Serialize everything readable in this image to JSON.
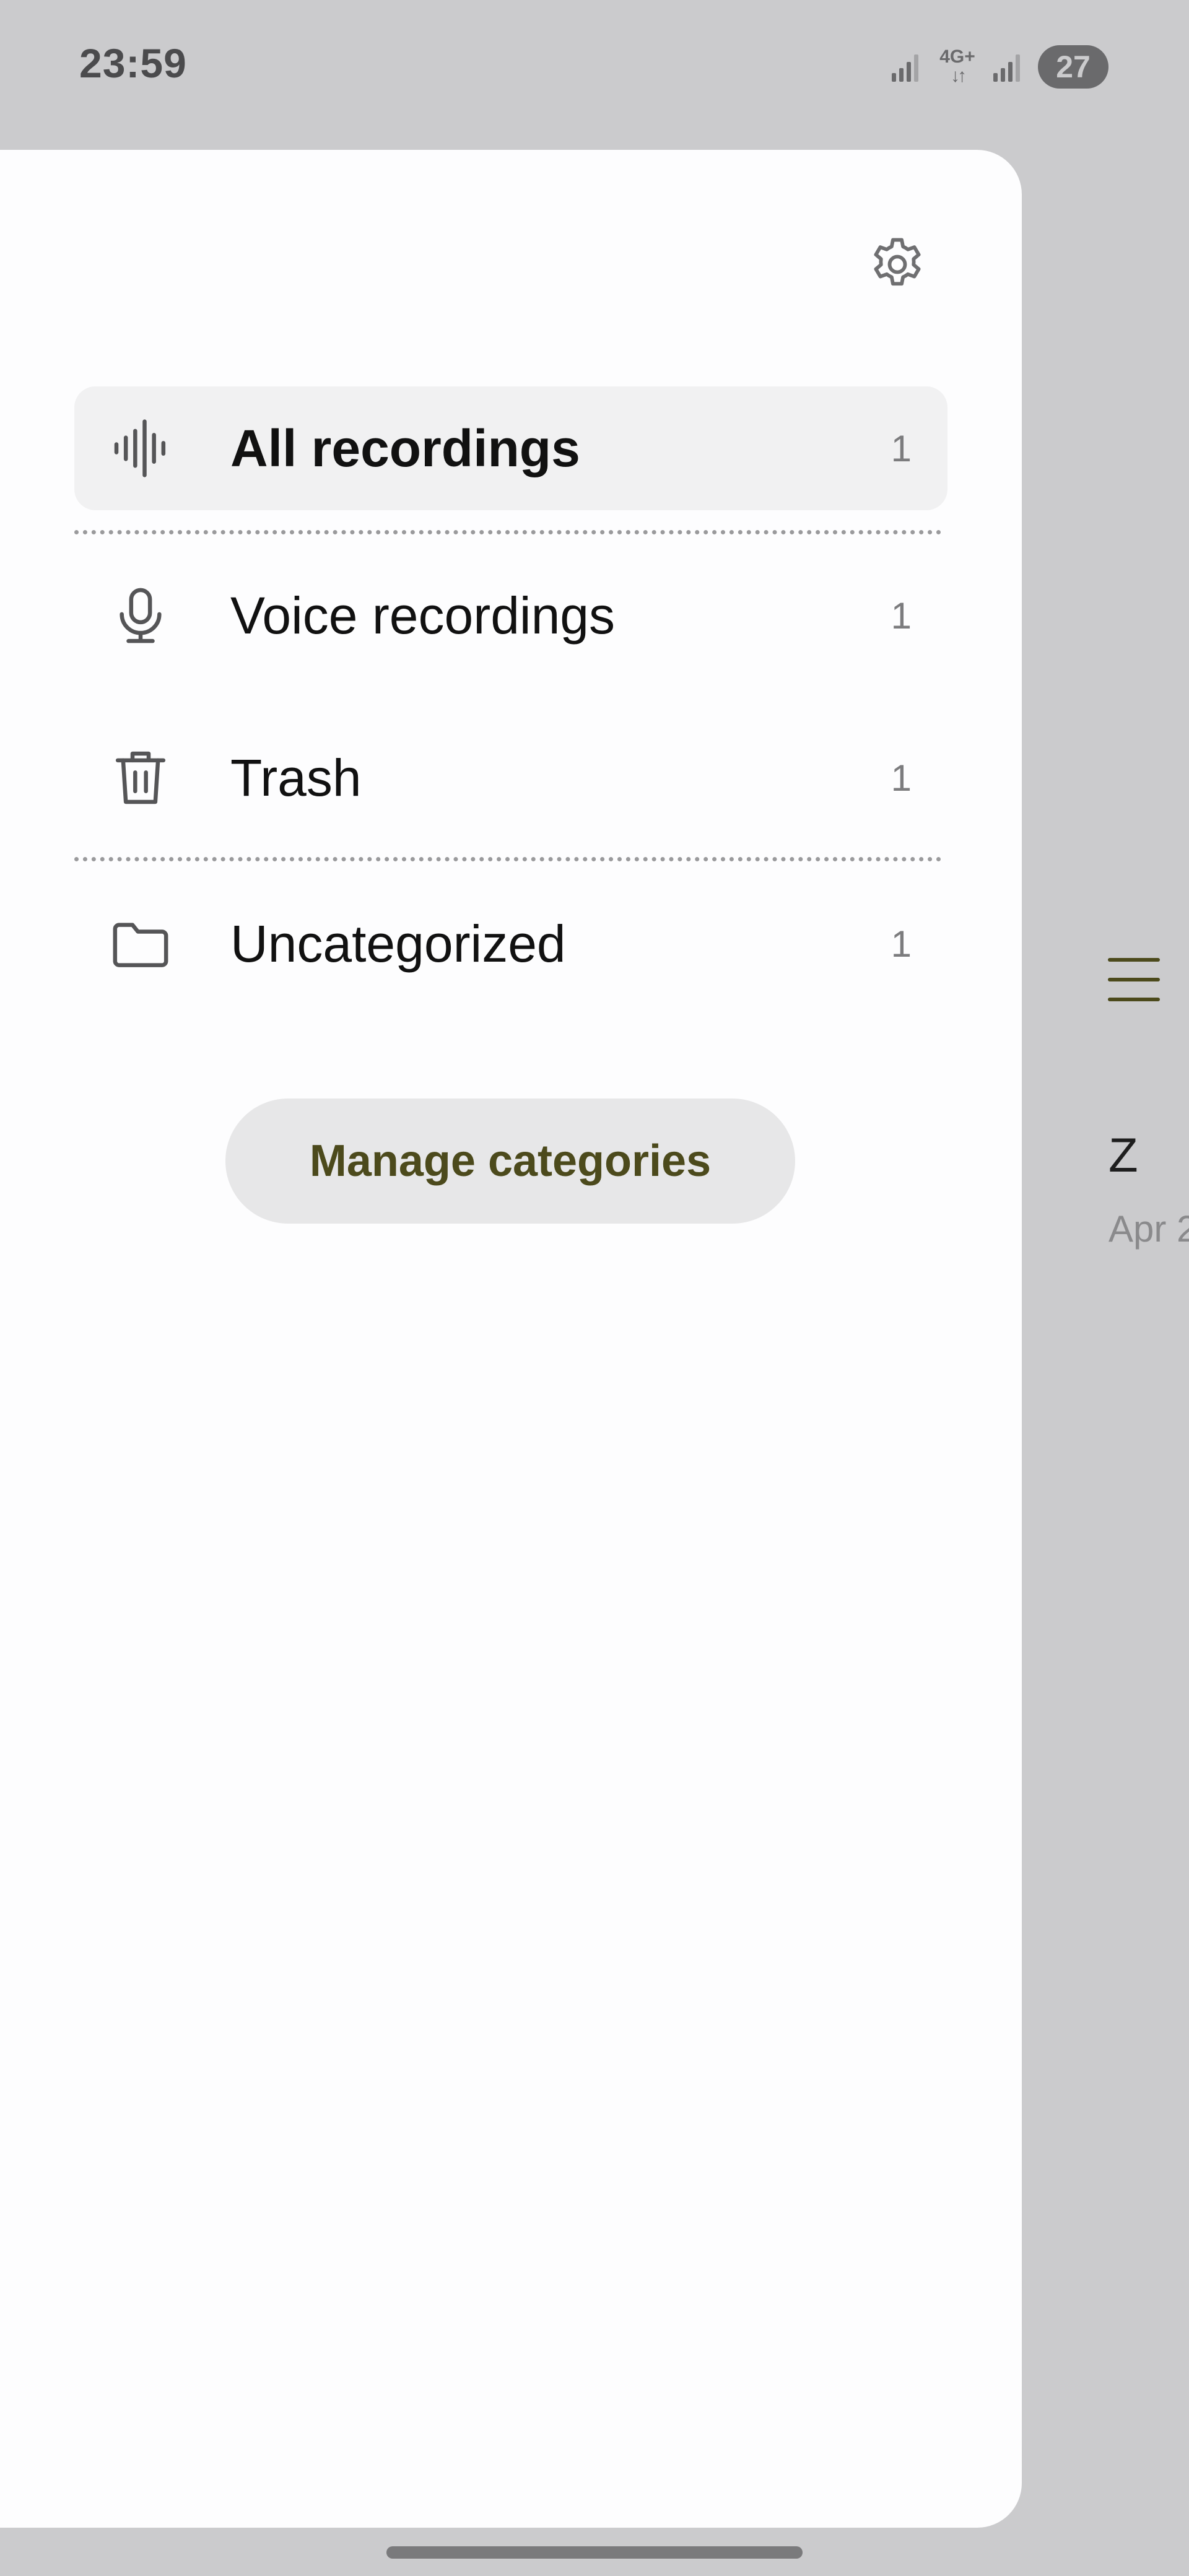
{
  "status_bar": {
    "time": "23:59",
    "network_type": "4G+",
    "network_arrows": "↓↑",
    "battery": "27",
    "icons": [
      "signal-icon",
      "network-type-icon",
      "signal-icon",
      "battery-icon"
    ]
  },
  "drawer": {
    "settings_icon": "gear-icon",
    "items": [
      {
        "label": "All recordings",
        "count": "1",
        "icon": "waveform-icon",
        "active": true
      },
      {
        "label": "Voice recordings",
        "count": "1",
        "icon": "microphone-icon",
        "active": false
      },
      {
        "label": "Trash",
        "count": "1",
        "icon": "trash-icon",
        "active": false
      },
      {
        "label": "Uncategorized",
        "count": "1",
        "icon": "folder-icon",
        "active": false
      }
    ],
    "manage_button_label": "Manage categories"
  },
  "background_page": {
    "menu_icon": "hamburger-menu-icon",
    "item_title": "Z",
    "item_date": "Apr 2"
  },
  "colors": {
    "scrim": "#cbcbcd",
    "drawer_bg": "#fdfdfe",
    "active_item_bg": "#f1f1f2",
    "accent_text": "#4c4a1c",
    "button_bg": "#e7e7e8"
  }
}
